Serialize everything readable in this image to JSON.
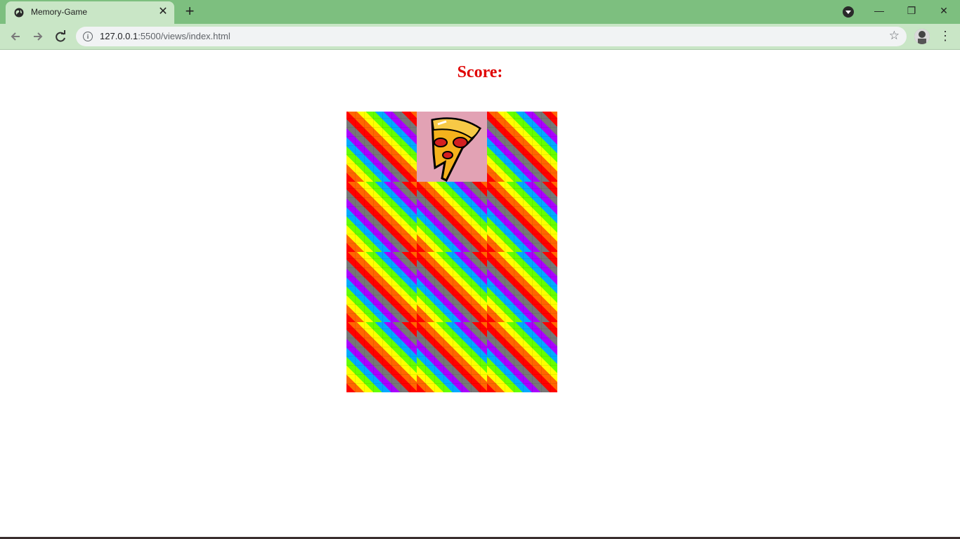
{
  "browser": {
    "tab_title": "Memory-Game",
    "tab_close": "✕",
    "new_tab": "+",
    "url_host": "127.0.0.1",
    "url_rest": ":5500/views/index.html"
  },
  "window_controls": {
    "minimize": "—",
    "restore": "❐",
    "close": "✕"
  },
  "game": {
    "score_label": "Score:",
    "cards": [
      {
        "state": "back"
      },
      {
        "state": "front",
        "image": "pizza-slice"
      },
      {
        "state": "back"
      },
      {
        "state": "back"
      },
      {
        "state": "back"
      },
      {
        "state": "back"
      },
      {
        "state": "back"
      },
      {
        "state": "back"
      },
      {
        "state": "back"
      },
      {
        "state": "back"
      },
      {
        "state": "back"
      },
      {
        "state": "back"
      }
    ]
  },
  "icons": {
    "globe": "globe-icon",
    "back": "arrow-left-icon",
    "forward": "arrow-right-icon",
    "reload": "reload-icon",
    "info": "info-icon",
    "star": "star-icon",
    "menu": "kebab-menu-icon"
  },
  "colors": {
    "score": "#e00000",
    "card_front_bg": "#e2a2b4",
    "chrome_frame": "#7dbf7f",
    "toolbar": "#c9e6c6"
  }
}
